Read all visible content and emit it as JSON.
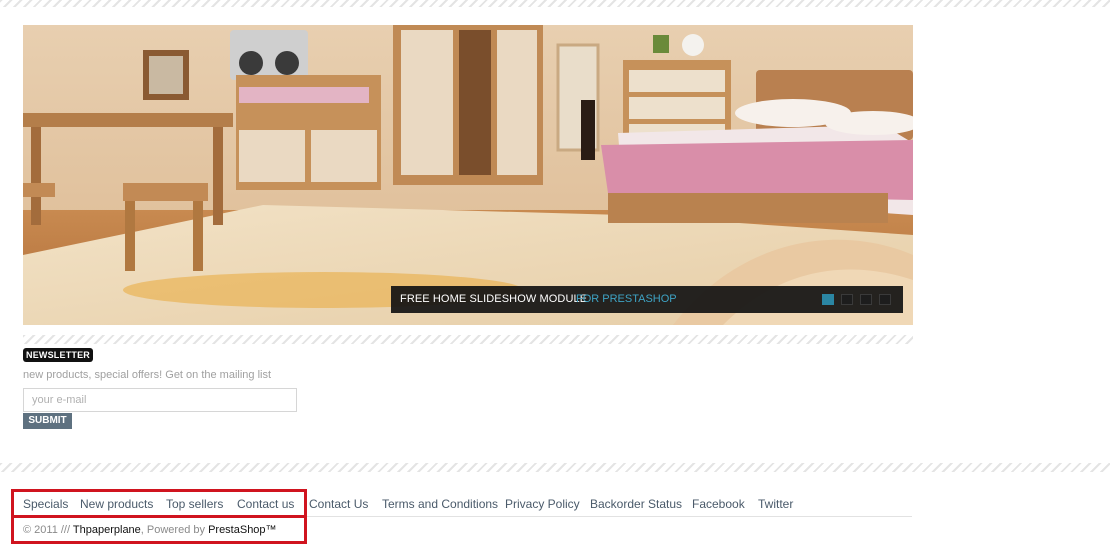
{
  "slideshow": {
    "caption_title": "FREE HOME SLIDESHOW MODULE",
    "caption_subtitle": "FOR PRESTASHOP",
    "slide_count": 4,
    "active_slide": 1,
    "accent_color": "#2b86a3"
  },
  "newsletter": {
    "title": "NEWSLETTER",
    "description": "new products, special offers! Get on the mailing list",
    "email_placeholder": "your e-mail",
    "submit_label": "SUBMIT"
  },
  "footer": {
    "links": [
      "Specials",
      "New products",
      "Top sellers",
      "Contact us",
      "Contact Us",
      "Terms and Conditions",
      "Privacy Policy",
      "Backorder Status",
      "Facebook",
      "Twitter"
    ],
    "copyright": {
      "prefix": "© 2011 /// ",
      "brand": "Thpaperplane",
      "powered_by": ", Powered by ",
      "platform": "PrestaShop",
      "suffix": "™"
    }
  },
  "colors": {
    "highlight_box": "#d0141f",
    "submit_button": "#5e7180",
    "caption_background": "#121212"
  }
}
